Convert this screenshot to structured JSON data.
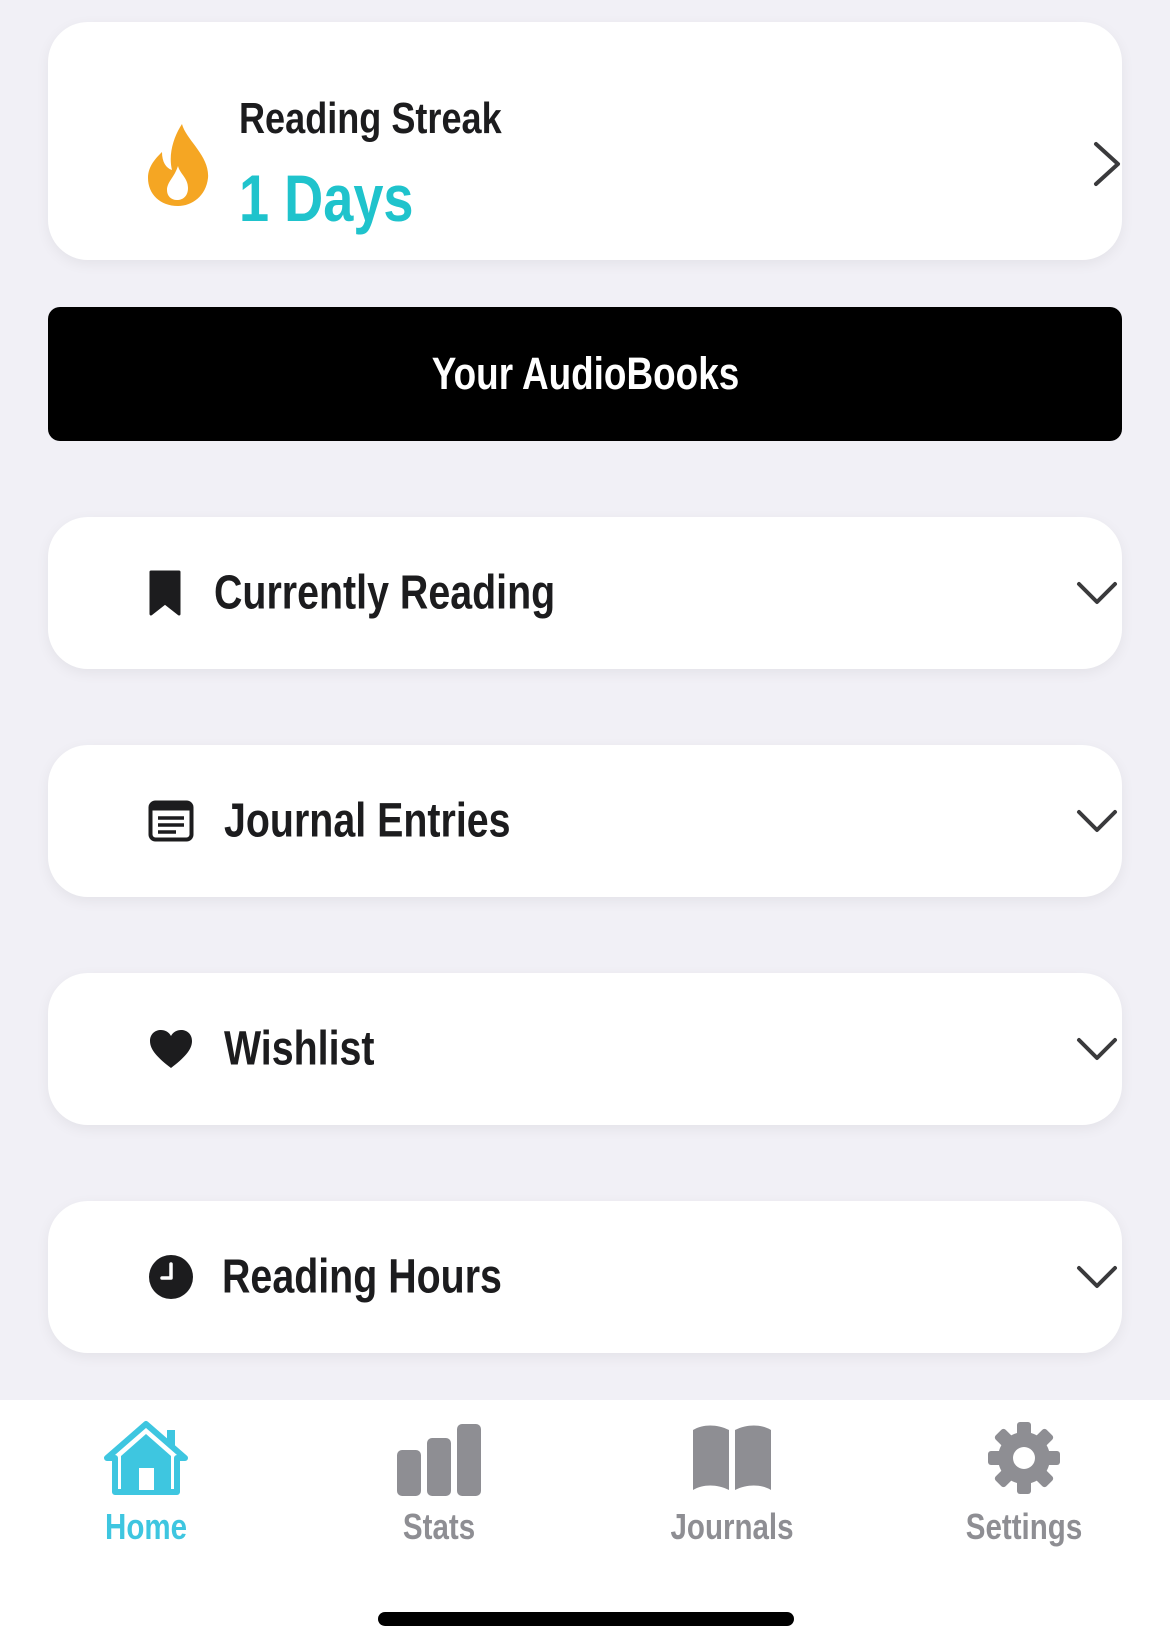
{
  "streak": {
    "title": "Reading Streak",
    "value": "1 Days",
    "icon": "flame-icon",
    "accent_color": "#1fc3cc",
    "flame_color": "#f5a623"
  },
  "audiobooks_button": {
    "label": "Your AudioBooks"
  },
  "sections": [
    {
      "label": "Currently Reading",
      "icon": "bookmark-icon"
    },
    {
      "label": "Journal Entries",
      "icon": "journal-icon"
    },
    {
      "label": "Wishlist",
      "icon": "heart-icon"
    },
    {
      "label": "Reading Hours",
      "icon": "clock-icon"
    }
  ],
  "tabbar": {
    "active_color": "#3ec6e0",
    "inactive_color": "#8e8e93",
    "tabs": [
      {
        "label": "Home",
        "icon": "home-icon",
        "active": true
      },
      {
        "label": "Stats",
        "icon": "stats-icon",
        "active": false
      },
      {
        "label": "Journals",
        "icon": "book-icon",
        "active": false
      },
      {
        "label": "Settings",
        "icon": "gear-icon",
        "active": false
      }
    ]
  }
}
